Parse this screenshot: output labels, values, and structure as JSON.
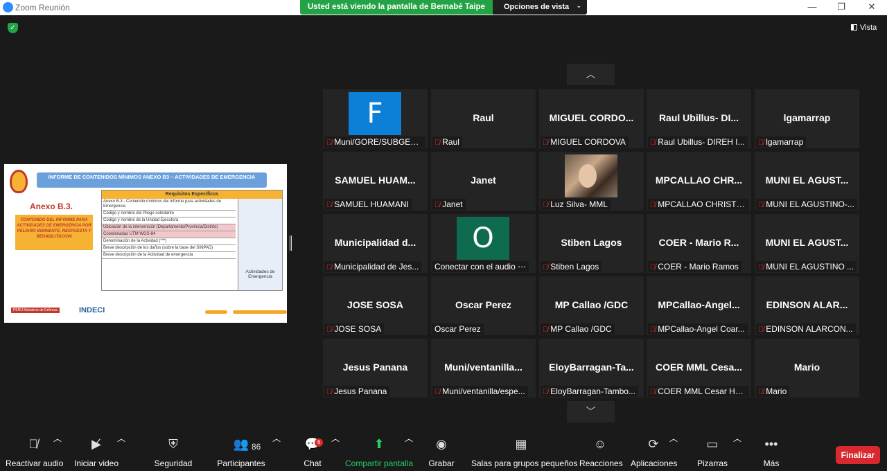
{
  "window": {
    "title": "Zoom Reunión",
    "minimize_icon": "—",
    "restore_icon": "❐",
    "close_icon": "✕"
  },
  "banner": {
    "message": "Usted está viendo la pantalla de Bernabé Taipe",
    "options_label": "Opciones de vista",
    "options_chevron": "⌄"
  },
  "vista_label": "Vista",
  "shared_screen": {
    "header": "INFORME DE CONTENIDOS MÍNIMOS ANEXO B3 – ACTIVIDADES DE EMERGENCIA",
    "anexo": "Anexo B.3.",
    "box_text": "CONTENIDO DEL INFORME PARA ACTIVIDADES DE EMERGENCIA POR PELIGRO INMINENTE, RESPUESTA Y REHABILITACION",
    "table_header": "Requisitos Específicos",
    "rows": [
      {
        "text": "Anexo B.3 - Contenido mínimos del Informe para actividades de Emergencia",
        "pink": false
      },
      {
        "text": "Código y nombre del Pliego solicitante",
        "pink": false
      },
      {
        "text": "Código y nombre de la Unidad Ejecutora",
        "pink": false
      },
      {
        "text": "Ubicación de la intervención (Departamento/Provincia/Distrito)",
        "pink": true
      },
      {
        "text": "Coordenadas UTM      WGS-84",
        "pink": true
      },
      {
        "text": "Denominación de la Actividad (***)",
        "pink": false
      },
      {
        "text": "Breve descripción de los daños (sobre la base del SINPAD)",
        "pink": false
      },
      {
        "text": "Breve descripción de la Actividad de emergencia",
        "pink": false
      }
    ],
    "side_text": "Actividades de Emergencia",
    "peru_label": "PERÚ  Ministerio de Defensa",
    "indeci_label": "INDECI"
  },
  "nav": {
    "up_icon": "︿",
    "down_icon": "﹀"
  },
  "participants": [
    {
      "name": "",
      "label": "Muni/GORE/SUBGER...",
      "muted": true,
      "avatar": "F",
      "avatar_color": "#0e7fd6"
    },
    {
      "name": "Raul",
      "label": "Raul",
      "muted": true
    },
    {
      "name": "MIGUEL  CORDO...",
      "label": "MIGUEL CORDOVA",
      "muted": true
    },
    {
      "name": "Raul Ubillus- DI...",
      "label": "Raul Ubillus- DIREH I...",
      "muted": true
    },
    {
      "name": "lgamarrap",
      "label": "lgamarrap",
      "muted": true
    },
    {
      "name": "SAMUEL  HUAM...",
      "label": "SAMUEL HUAMANI",
      "muted": true
    },
    {
      "name": "Janet",
      "label": "Janet",
      "muted": true
    },
    {
      "name": "",
      "label": "Luz Silva- MML",
      "muted": true,
      "photo": true
    },
    {
      "name": "MPCALLAO  CHR...",
      "label": "MPCALLAO CHRISTIA...",
      "muted": true
    },
    {
      "name": "MUNI EL AGUST...",
      "label": "MUNI EL AGUSTINO-...",
      "muted": true
    },
    {
      "name": "Municipalidad  d...",
      "label": "Municipalidad de Jes...",
      "muted": true
    },
    {
      "name": "",
      "label": "Conectar con el audio ⋯",
      "muted": false,
      "avatar": "O",
      "avatar_color": "#0f6b4f"
    },
    {
      "name": "Stiben Lagos",
      "label": "Stiben Lagos",
      "muted": true
    },
    {
      "name": "COER - Mario R...",
      "label": "COER - Mario Ramos",
      "muted": true
    },
    {
      "name": "MUNI EL AGUST...",
      "label": "MUNI EL AGUSTINO ...",
      "muted": true
    },
    {
      "name": "JOSE SOSA",
      "label": "JOSE SOSA",
      "muted": true
    },
    {
      "name": "Oscar Perez",
      "label": "Oscar Perez",
      "muted": false
    },
    {
      "name": "MP Callao /GDC",
      "label": "MP Callao /GDC",
      "muted": true
    },
    {
      "name": "MPCallao-Angel...",
      "label": "MPCallao-Angel Coar...",
      "muted": true
    },
    {
      "name": "EDINSON  ALAR...",
      "label": "EDINSON  ALARCON...",
      "muted": true
    },
    {
      "name": "Jesus Panana",
      "label": "Jesus Panana",
      "muted": true
    },
    {
      "name": "Muni/ventanilla...",
      "label": "Muni/ventanilla/espe...",
      "muted": true
    },
    {
      "name": "EloyBarragan-Ta...",
      "label": "EloyBarragan-Tambo...",
      "muted": true
    },
    {
      "name": "COER  MML  Cesa...",
      "label": "COER MML Cesar Hu...",
      "muted": true
    },
    {
      "name": "Mario",
      "label": "Mario",
      "muted": true
    }
  ],
  "toolbar": {
    "audio": "Reactivar audio",
    "video": "Iniciar video",
    "security": "Seguridad",
    "participants": "Participantes",
    "participants_count": "86",
    "chat": "Chat",
    "chat_badge": "6",
    "share": "Compartir pantalla",
    "record": "Grabar",
    "breakout": "Salas para grupos pequeños",
    "reactions": "Reacciones",
    "apps": "Aplicaciones",
    "whiteboards": "Pizarras",
    "more": "Más",
    "end": "Finalizar"
  },
  "icons": {
    "mic_muted": "mic-muted-icon",
    "video_off": "video-off-icon",
    "shield": "shield-icon",
    "people": "people-icon",
    "chat": "chat-bubble-icon",
    "share": "share-up-arrow-icon",
    "record": "record-icon",
    "breakout": "grid-icon",
    "reactions": "smiley-icon",
    "apps": "apps-icon",
    "whiteboard": "whiteboard-icon",
    "more": "more-dots-icon"
  }
}
